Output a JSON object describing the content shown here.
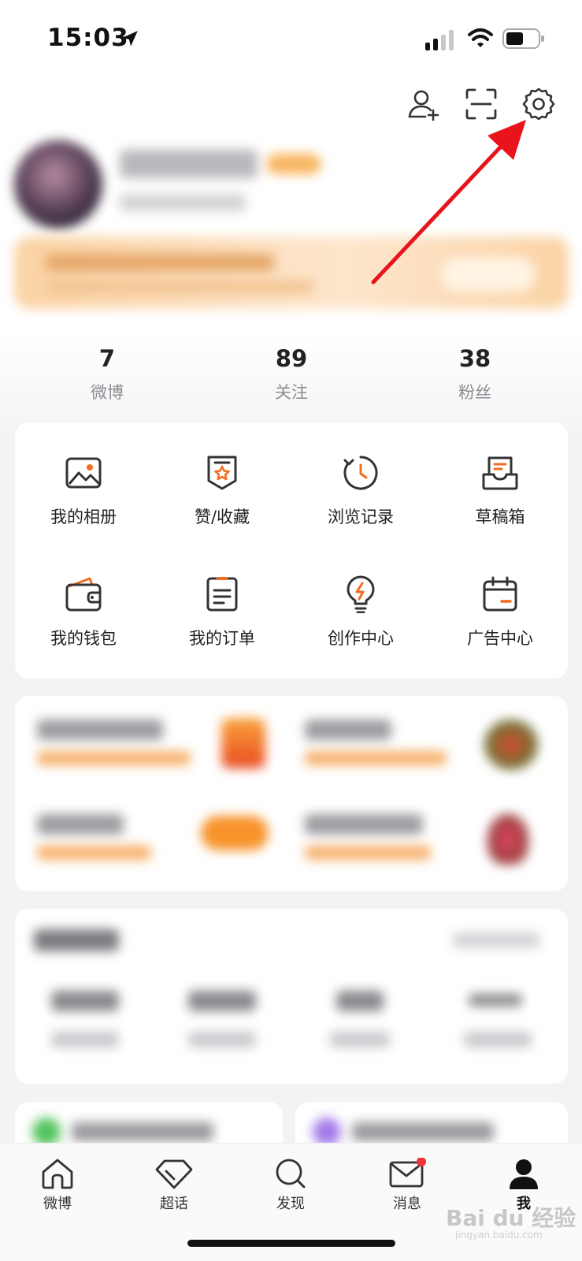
{
  "status_bar": {
    "time": "15:03"
  },
  "stats": [
    {
      "value": "7",
      "label": "微博"
    },
    {
      "value": "89",
      "label": "关注"
    },
    {
      "value": "38",
      "label": "粉丝"
    }
  ],
  "grid": [
    {
      "label": "我的相册",
      "icon": "photo-album-icon"
    },
    {
      "label": "赞/收藏",
      "icon": "favorite-badge-icon"
    },
    {
      "label": "浏览记录",
      "icon": "history-clock-icon"
    },
    {
      "label": "草稿箱",
      "icon": "drafts-tray-icon"
    },
    {
      "label": "我的钱包",
      "icon": "wallet-icon"
    },
    {
      "label": "我的订单",
      "icon": "order-list-icon"
    },
    {
      "label": "创作中心",
      "icon": "lightbulb-icon"
    },
    {
      "label": "广告中心",
      "icon": "calendar-ad-icon"
    }
  ],
  "tabs": [
    {
      "label": "微博",
      "icon": "home-icon"
    },
    {
      "label": "超话",
      "icon": "diamond-icon"
    },
    {
      "label": "发现",
      "icon": "search-icon"
    },
    {
      "label": "消息",
      "icon": "mail-icon"
    },
    {
      "label": "我",
      "icon": "person-icon"
    }
  ],
  "watermark": {
    "main": "Bai du 经验",
    "sub": "jingyan.baidu.com"
  },
  "colors": {
    "accent": "#f26d1f",
    "annotation": "#e8141c",
    "icon_stroke": "#333333"
  }
}
